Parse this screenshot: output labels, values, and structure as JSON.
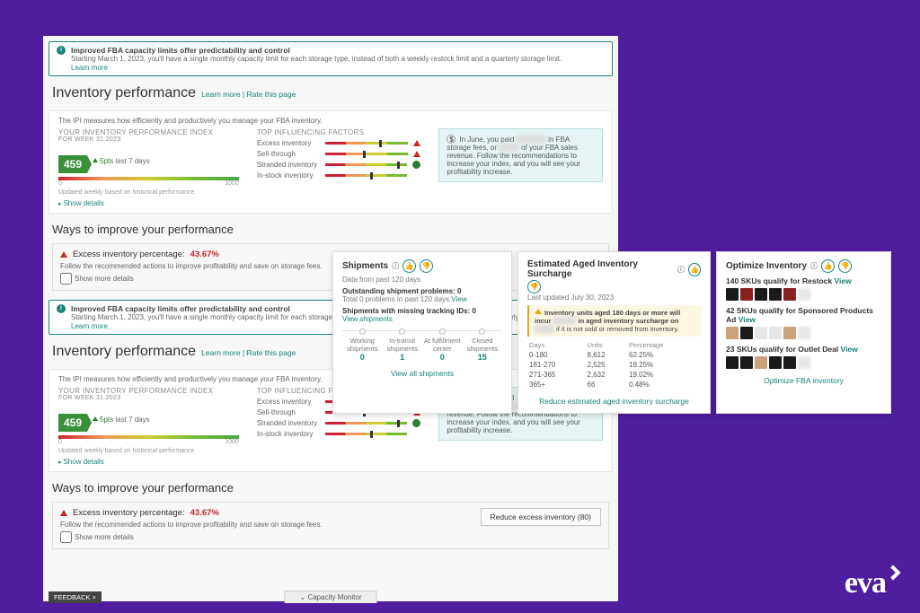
{
  "banner": {
    "title": "Improved FBA capacity limits offer predictability and control",
    "body": "Starting March 1, 2023, you'll have a single monthly capacity limit for each storage type, instead of both a weekly restock limit and a quarterly storage limit.",
    "learn": "Learn more"
  },
  "page": {
    "title": "Inventory performance",
    "learn": "Learn more",
    "rate": "Rate this page",
    "ipi_intro": "The IPI measures how efficiently and productively you manage your FBA inventory."
  },
  "ipi": {
    "label": "YOUR INVENTORY PERFORMANCE INDEX",
    "week": "FOR WEEK 31 2023",
    "score": "459",
    "trend": "5pts",
    "trend_period": "last 7 days",
    "min": "0",
    "max": "1000",
    "updated": "Updated weekly based on historical performance",
    "show": "Show details"
  },
  "factors": {
    "label": "TOP INFLUENCING FACTORS",
    "items": [
      {
        "name": "Excess inventory",
        "status": "warn"
      },
      {
        "name": "Sell-through",
        "status": "warn"
      },
      {
        "name": "Stranded inventory",
        "status": "ok"
      },
      {
        "name": "In-stock inventory",
        "status": "none"
      }
    ]
  },
  "fee": {
    "text_a": "In June, you paid",
    "text_b": "in FBA storage fees, or",
    "text_c": "of your FBA sales revenue. Follow the recommendations to increase your index, and you will see your profitability increase."
  },
  "improve": {
    "title": "Ways to improve your performance",
    "excess_label": "Excess inventory percentage:",
    "excess_pct": "43.67%",
    "excess_sub": "Follow the recommended actions to improve profitability and save on storage fees.",
    "more": "Show more details",
    "reduce_btn": "Reduce excess inventory (80)"
  },
  "footer": {
    "feedback": "FEEDBACK ×",
    "capacity": "Capacity Monitor"
  },
  "shipments": {
    "title": "Shipments",
    "sub": "Data from past 120 days",
    "problems_label": "Outstanding shipment problems:",
    "problems_n": "0",
    "problems_sub": "Total 0 problems in past 120 days",
    "view": "View",
    "tracking_label": "Shipments with missing tracking IDs:",
    "tracking_n": "0",
    "view_ship": "View shipments",
    "cols": [
      {
        "label": "Working shipments",
        "n": "0"
      },
      {
        "label": "In-transit shipments",
        "n": "1"
      },
      {
        "label": "At fulfillment center",
        "n": "0"
      },
      {
        "label": "Closed shipments",
        "n": "15"
      }
    ],
    "view_all": "View all shipments"
  },
  "aged": {
    "title": "Estimated Aged Inventory Surcharge",
    "updated": "Last updated July 30, 2023",
    "warn_a": "Inventory units aged 180 days or more will incur",
    "warn_b": "in aged inventory surcharge on",
    "warn_c": "if it is not sold or removed from inventory.",
    "th_days": "Days",
    "th_units": "Units",
    "th_pct": "Percentage",
    "rows": [
      {
        "d": "0-180",
        "u": "8,612",
        "p": "62.25%"
      },
      {
        "d": "181-270",
        "u": "2,525",
        "p": "18.25%"
      },
      {
        "d": "271-365",
        "u": "2,632",
        "p": "19.02%"
      },
      {
        "d": "365+",
        "u": "66",
        "p": "0.48%"
      }
    ],
    "link": "Reduce estimated aged inventory surcharge"
  },
  "optimize": {
    "title": "Optimize Inventory",
    "lines": [
      {
        "t": "140 SKUs qualify for Restock",
        "v": "View"
      },
      {
        "t": "42 SKUs qualify for Sponsored Products Ad",
        "v": "View"
      },
      {
        "t": "23 SKUs qualify for Outlet Deal",
        "v": "View"
      }
    ],
    "link": "Optimize FBA inventory"
  },
  "logo": "eva"
}
